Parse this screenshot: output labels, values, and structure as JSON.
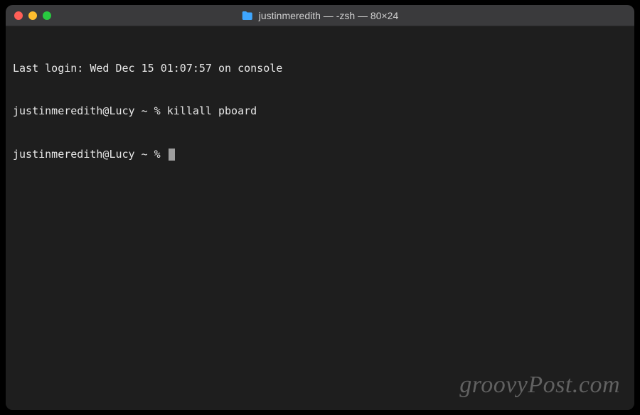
{
  "titlebar": {
    "icon": "folder-icon",
    "title": "justinmeredith — -zsh — 80×24"
  },
  "terminal": {
    "lines": [
      "Last login: Wed Dec 15 01:07:57 on console",
      "justinmeredith@Lucy ~ % killall pboard"
    ],
    "current_prompt": "justinmeredith@Lucy ~ % "
  },
  "watermark": "groovyPost.com"
}
